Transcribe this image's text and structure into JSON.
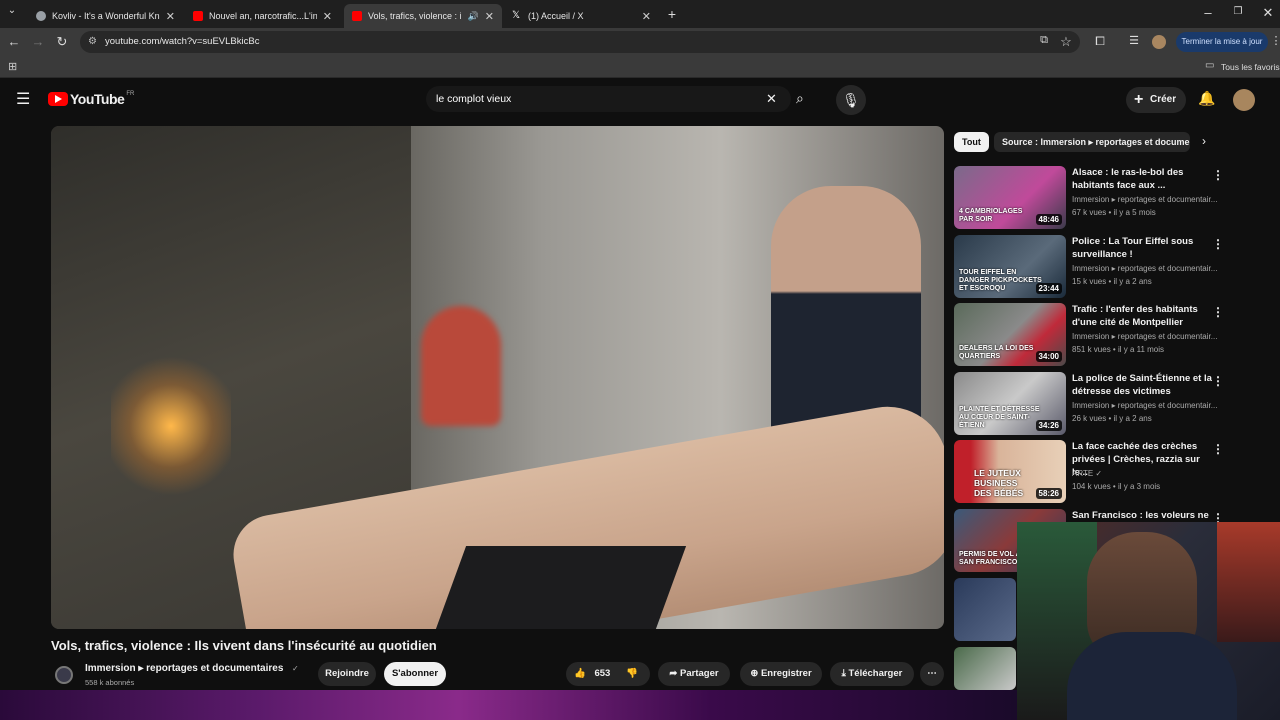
{
  "browser": {
    "tabs": [
      {
        "title": "Kovliv - It's a Wonderful Knife [",
        "color": "#9aa0a6"
      },
      {
        "title": "Nouvel an, narcotrafic...L'interv",
        "color": "#ff0000"
      },
      {
        "title": "Vols, trafics, violence : ils vi",
        "color": "#ff0000"
      },
      {
        "title": "(1) Accueil / X",
        "color": "#ffffff"
      }
    ],
    "url": "youtube.com/watch?v=suEVLBkicBc",
    "update_label": "Terminer la mise à jour",
    "bookmarks_label": "Tous les favoris"
  },
  "header": {
    "logo_text": "YouTube",
    "country": "FR",
    "search_value": "le complot vieux",
    "create_label": "Créer"
  },
  "video": {
    "title": "Vols, trafics, violence : Ils vivent dans l'insécurité au quotidien",
    "channel": "Immersion ▸ reportages et documentaires",
    "subscribers": "558 k abonnés",
    "join_label": "Rejoindre",
    "subscribe_label": "S'abonner",
    "likes": "653",
    "share_label": "Partager",
    "save_label": "Enregistrer",
    "download_label": "Télécharger"
  },
  "sidebar": {
    "chips": [
      "Tout",
      "Source : Immersion ▸ reportages et docume"
    ],
    "recommendations": [
      {
        "title": "Alsace : le ras-le-bol des habitants face aux ...",
        "channel": "Immersion ▸ reportages et documentair...",
        "meta": "67 k vues • il y a 5 mois",
        "duration": "48:46",
        "overlay": "4 CAMBRIOLAGES PAR SOIR",
        "thumb_color": "#6a5a7a"
      },
      {
        "title": "Police : La Tour Eiffel sous surveillance !",
        "channel": "Immersion ▸ reportages et documentair...",
        "meta": "15 k vues • il y a 2 ans",
        "duration": "23:44",
        "overlay": "TOUR EIFFEL EN DANGER PICKPOCKETS ET ESCROQU",
        "thumb_color": "#3a4a5a"
      },
      {
        "title": "Trafic : l'enfer des habitants d'une cité de Montpellier",
        "channel": "Immersion ▸ reportages et documentair...",
        "meta": "851 k vues • il y a 11 mois",
        "duration": "34:00",
        "overlay": "DEALERS LA LOI DES QUARTIERS",
        "thumb_color": "#5a5a5a"
      },
      {
        "title": "La police de Saint-Étienne et la détresse des victimes",
        "channel": "Immersion ▸ reportages et documentair...",
        "meta": "26 k vues • il y a 2 ans",
        "duration": "34:26",
        "overlay": "PLAINTE ET DÉTRESSE AU CŒUR DE SAINT-ÉTIENN",
        "thumb_color": "#6a6a6a"
      },
      {
        "title": "La face cachée des crèches privées | Crèches, razzia sur le...",
        "channel": "ARTE ✓",
        "meta": "104 k vues • il y a 3 mois",
        "duration": "58:26",
        "overlay": "LE JUTEUX BUSINESS DES BÉBÉS",
        "thumb_color": "#8a3a3a"
      },
      {
        "title": "San Francisco : les voleurs ne",
        "channel": "",
        "meta": "",
        "duration": "",
        "overlay": "PERMIS DE VOL À SAN FRANCISCO",
        "thumb_color": "#3a4a6a"
      }
    ]
  }
}
